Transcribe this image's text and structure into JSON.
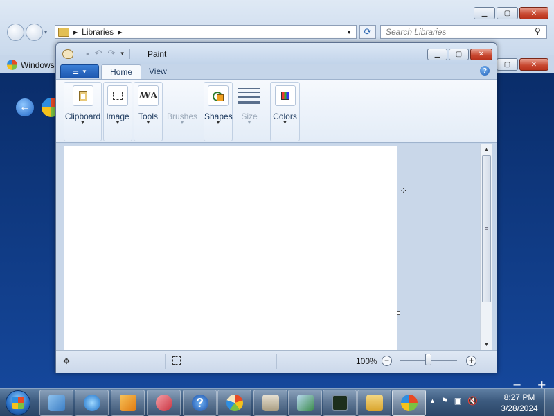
{
  "explorer": {
    "address_segment": "Libraries",
    "search_placeholder": "Search Libraries"
  },
  "help_window": {
    "title": "Windows"
  },
  "paint": {
    "title": "Paint",
    "tabs": [
      {
        "label": "Home",
        "active": true
      },
      {
        "label": "View",
        "active": false
      }
    ],
    "groups": [
      {
        "label": "Clipboard",
        "icon": "clipboard-icon",
        "enabled": true
      },
      {
        "label": "Image",
        "icon": "select-icon",
        "enabled": true
      },
      {
        "label": "Tools",
        "icon": "tools-icon",
        "enabled": true
      },
      {
        "label": "Brushes",
        "icon": "brush-icon",
        "enabled": false
      },
      {
        "label": "Shapes",
        "icon": "shapes-icon",
        "enabled": true
      },
      {
        "label": "Size",
        "icon": "size-icon",
        "enabled": false
      },
      {
        "label": "Colors",
        "icon": "colors-icon",
        "enabled": true
      }
    ],
    "zoom_level": "100%"
  },
  "taskbar": {
    "time": "8:27 PM",
    "date": "3/28/2024",
    "pinned": [
      "control-panel-icon",
      "internet-explorer-icon",
      "media-center-icon",
      "snipping-tool-icon",
      "help-icon",
      "paint-icon",
      "archive-icon",
      "network-icon",
      "task-manager-icon",
      "explorer-icon",
      "windows-help-icon"
    ]
  },
  "colors": {
    "accent": "#1d58b0",
    "close_button": "#c7462e",
    "canvas": "#ffffff"
  }
}
